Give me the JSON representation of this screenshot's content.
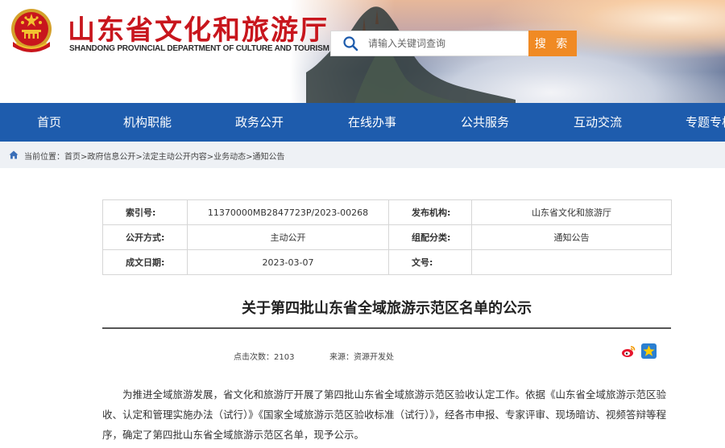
{
  "header": {
    "title": "山东省文化和旅游厅",
    "subtitle": "SHANDONG PROVINCIAL DEPARTMENT OF CULTURE AND TOURISM",
    "emblem_icon": "national-emblem-icon"
  },
  "search": {
    "placeholder": "请输入关键词查询",
    "button_label": "搜 索",
    "icon": "search-icon"
  },
  "nav": {
    "items": [
      "首页",
      "机构职能",
      "政务公开",
      "在线办事",
      "公共服务",
      "互动交流",
      "专题专栏"
    ]
  },
  "breadcrumb": {
    "icon": "home-icon",
    "text": "当前位置：首页>政府信息公开>法定主动公开内容>业务动态>通知公告"
  },
  "info_table": {
    "index_label": "索引号:",
    "index_value": "11370000MB2847723P/2023-00268",
    "publisher_label": "发布机构:",
    "publisher_value": "山东省文化和旅游厅",
    "disclosure_label": "公开方式:",
    "disclosure_value": "主动公开",
    "category_label": "组配分类:",
    "category_value": "通知公告",
    "date_label": "成文日期:",
    "date_value": "2023-03-07",
    "docno_label": "文号:",
    "docno_value": ""
  },
  "article": {
    "title": "关于第四批山东省全域旅游示范区名单的公示",
    "views_label": "点击次数：",
    "views_value": "2103",
    "source_label": "来源：",
    "source_value": "资源开发处",
    "share_icons": [
      "weibo-share-icon",
      "qzone-share-icon"
    ],
    "body": "为推进全域旅游发展，省文化和旅游厅开展了第四批山东省全域旅游示范区验收认定工作。依据《山东省全域旅游示范区验收、认定和管理实施办法（试行）》《国家全域旅游示范区验收标准（试行）》，经各市申报、专家评审、现场暗访、视频答辩等程序，确定了第四批山东省全域旅游示范区名单，现予公示。"
  },
  "colors": {
    "brand_red": "#c8161d",
    "nav_blue": "#1e5cad",
    "search_orange": "#f08a24"
  }
}
